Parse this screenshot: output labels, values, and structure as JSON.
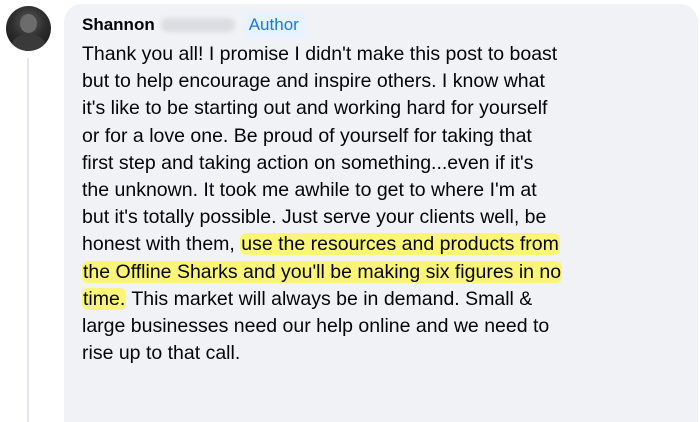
{
  "comment": {
    "author_name": "Shannon",
    "badge": "Author",
    "lines": [
      "Thank you all! I promise I didn't make this post to boast",
      "but to help encourage and inspire others. I know what",
      "it's like to be starting out and working hard for yourself",
      "or for a love one. Be proud of yourself for taking that",
      "first step and taking action on something...even if it's",
      "the unknown. It took me awhile to get to where I'm at",
      "but it's totally possible. Just serve your clients well, be"
    ],
    "line8_plain": "honest with them, ",
    "line8_highlight": "use the resources and products from",
    "line9_highlight": "the Offline Sharks and you'll be making six figures in no",
    "line10_highlight": "time.",
    "line10_plain": " This market will always be in demand. Small &",
    "lines_end": [
      "large businesses need our help online and we need to",
      "rise up to that call."
    ],
    "highlight_color": "#faf578"
  }
}
